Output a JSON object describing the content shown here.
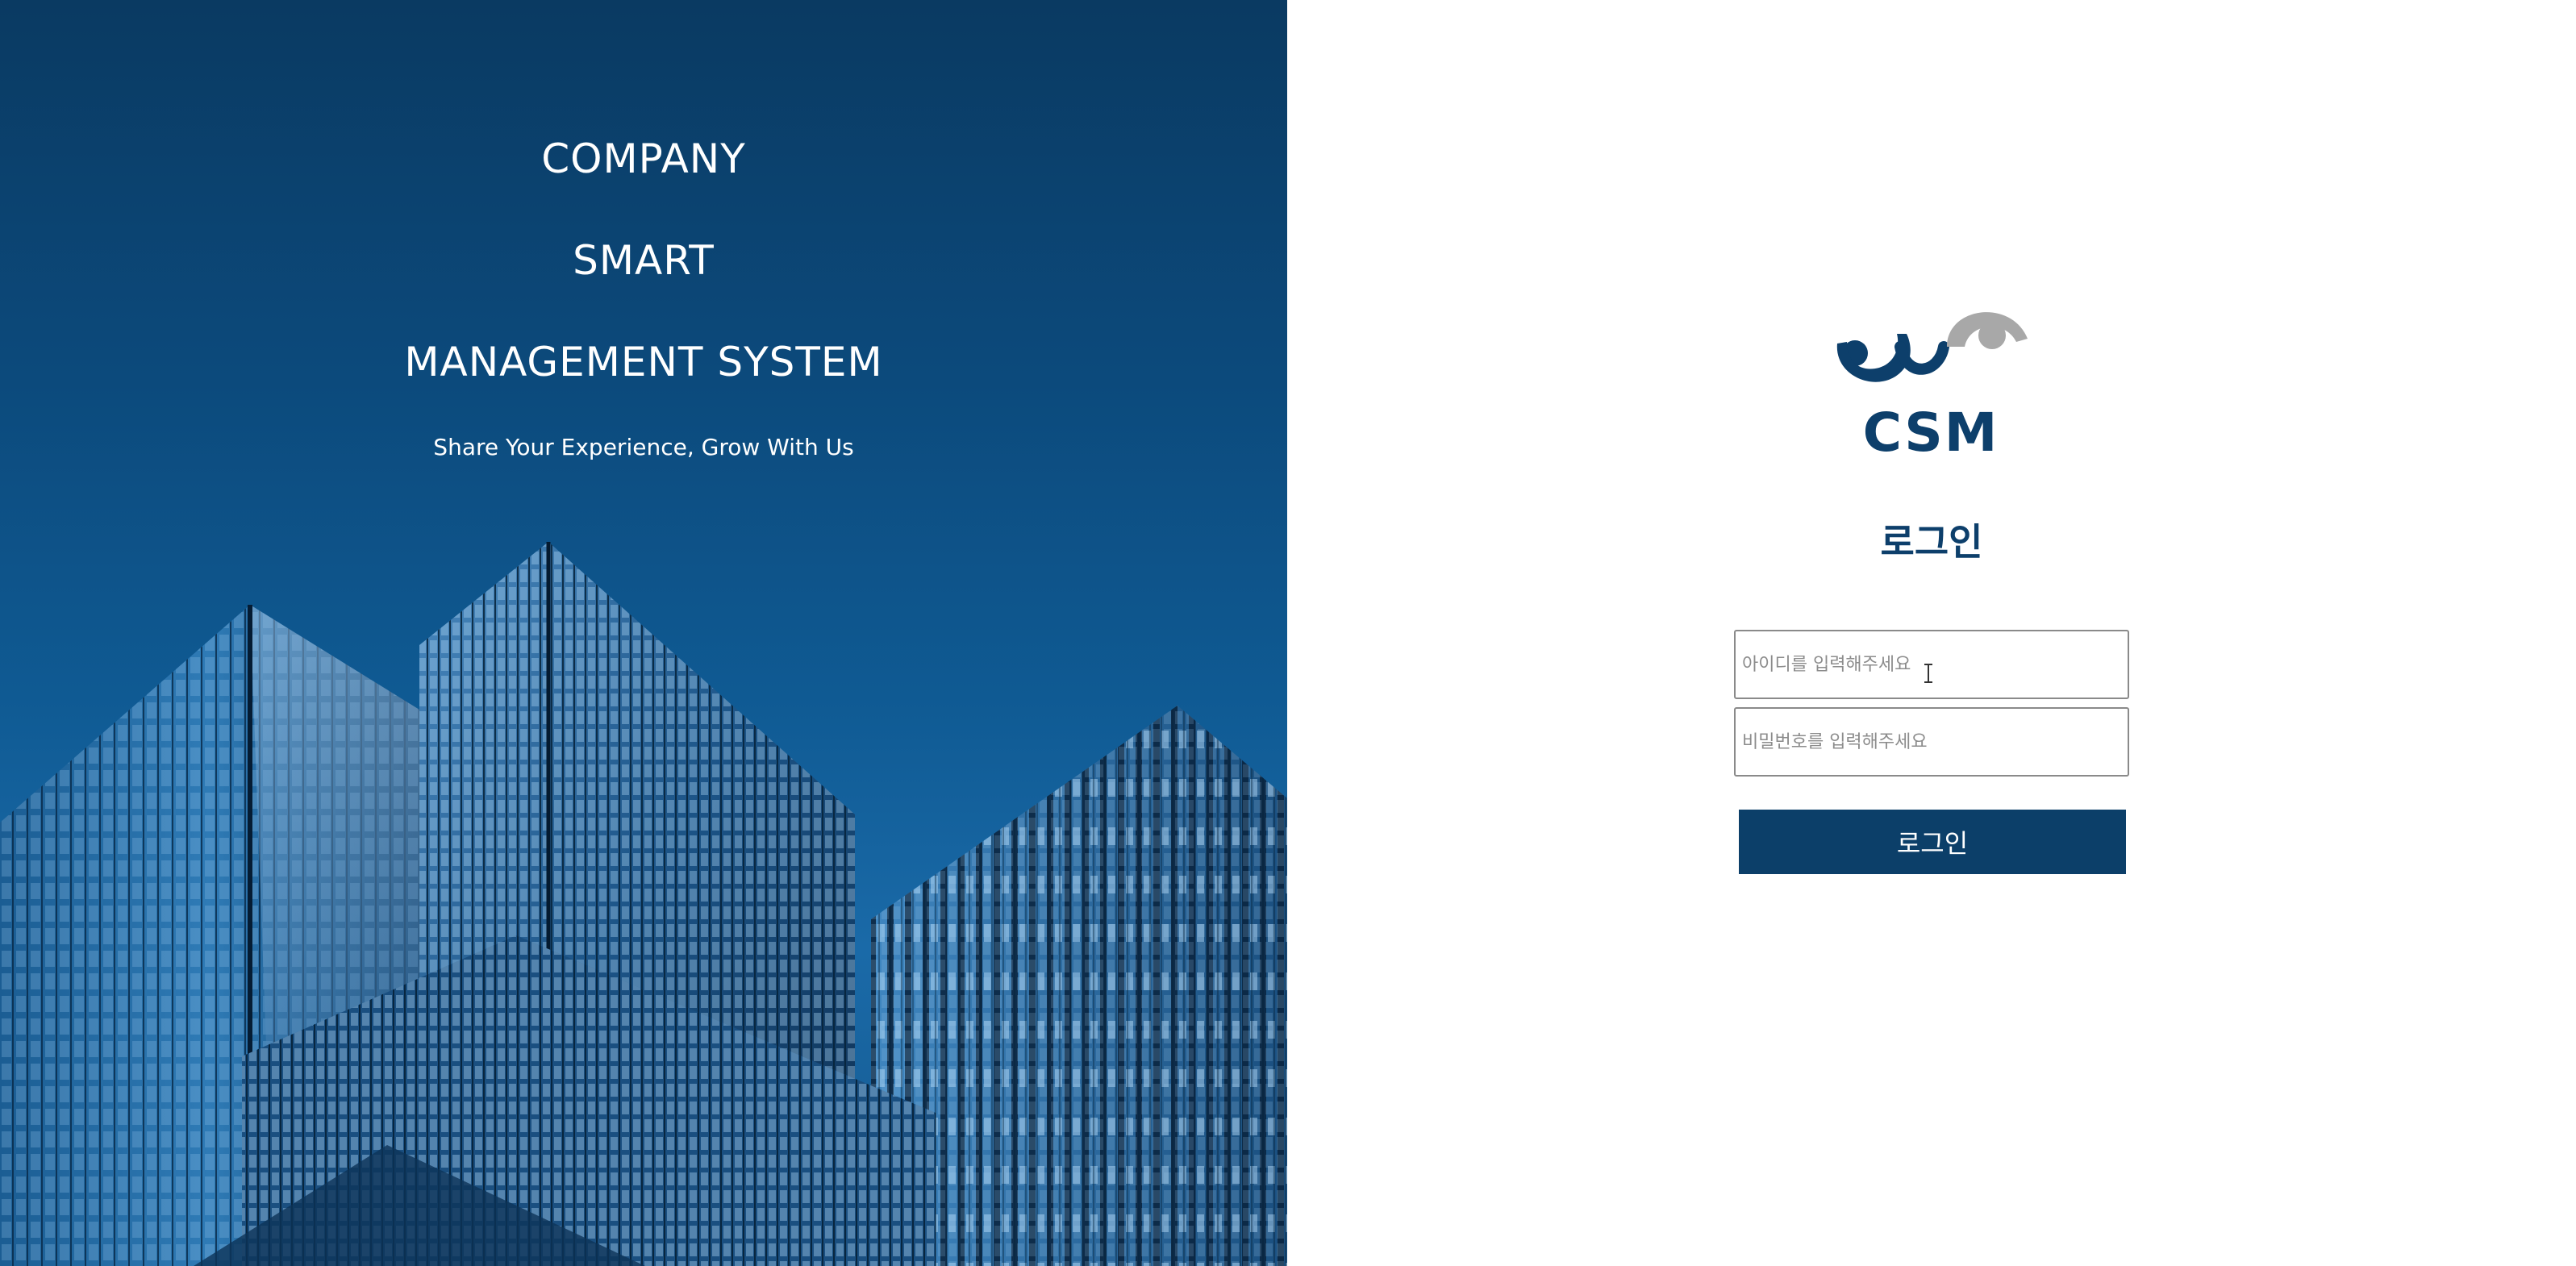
{
  "hero": {
    "line1": "COMPANY",
    "line2": "SMART",
    "line3": "MANAGEMENT SYSTEM",
    "tagline": "Share Your Experience, Grow With Us"
  },
  "logo": {
    "text": "CSM",
    "primary_color": "#0d3f6b",
    "secondary_color": "#a8a8a8"
  },
  "login": {
    "title": "로그인",
    "id_placeholder": "아이디를 입력해주세요",
    "password_placeholder": "비밀번호를 입력해주세요",
    "button_label": "로그인",
    "button_color": "#0c3f69"
  }
}
